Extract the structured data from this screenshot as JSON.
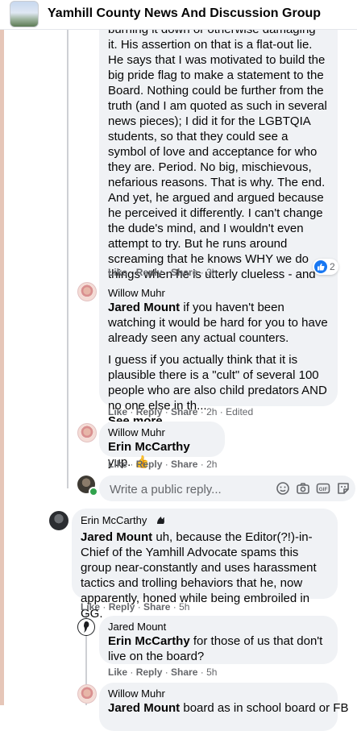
{
  "header": {
    "group_name": "Yamhill County News And Discussion Group"
  },
  "comments": [
    {
      "paragraph": "burning it down or otherwise damaging it. His assertion on that is a flat-out lie. He says that I was motivated to build the big pride flag to make a statement to the Board. Nothing could be further from the truth (and I am quoted as such in several news pieces); I did it for the LGBTQIA students, so that they could see a symbol of love and acceptance for who they are. Period. No big, mischievous, nefarious reasons. That is why. The end. And yet, he argued and argued because he perceived it differently. I can't change the dude's mind, and I wouldn't even attempt to try. But he runs around screaming that he knows WHY we do things when he is utterly clueless - and he dismisses what we say out of hand, even in direct conversation with him.",
      "actions": {
        "like": "Like",
        "reply": "Reply",
        "share": "Share",
        "time": "3h"
      },
      "reaction_count": "2"
    },
    {
      "author": "Willow Muhr",
      "mention": "Jared Mount",
      "text": " if you haven't been watching it would be hard for you to have already seen any actual counters.",
      "paragraph2": "I guess if you actually think that it is plausible there is a \"cult\" of several 100 people who are also child predators AND no one else in th...",
      "see_more": "See more",
      "actions": {
        "like": "Like",
        "reply": "Reply",
        "share": "Share",
        "time": "2h",
        "edited": "Edited"
      }
    },
    {
      "author": "Willow Muhr",
      "mention": "Erin McCarthy",
      "text": " yup. 👍",
      "actions": {
        "like": "Like",
        "reply": "Reply",
        "share": "Share",
        "time": "2h"
      }
    },
    {
      "author": "Erin McCarthy",
      "mention": "Jared Mount",
      "text": " uh, because the Editor(?!)-in-Chief of the Yamhill Advocate spams this group near-constantly and uses harassment tactics and trolling behaviors that he, now apparently, honed while being embroiled in GG.",
      "actions": {
        "like": "Like",
        "reply": "Reply",
        "share": "Share",
        "time": "5h"
      }
    },
    {
      "author": "Jared Mount",
      "mention": "Erin McCarthy",
      "text": " for those of us that don't live on the board?",
      "actions": {
        "like": "Like",
        "reply": "Reply",
        "share": "Share",
        "time": "5h"
      }
    },
    {
      "author": "Willow Muhr",
      "mention": "Jared Mount",
      "text": " board as in school board or FB"
    }
  ],
  "reply_box": {
    "placeholder": "Write a public reply..."
  },
  "icons": {
    "emoji": "smiley-icon",
    "camera": "camera-icon",
    "gif": "gif-icon",
    "sticker": "sticker-icon",
    "badge": "rising-fan-badge-icon",
    "reaction": "like-reaction-icon"
  },
  "colors": {
    "bubble": "#f0f2f5",
    "meta": "#65676b",
    "like_blue": "#1877f2",
    "online": "#31a24c"
  }
}
